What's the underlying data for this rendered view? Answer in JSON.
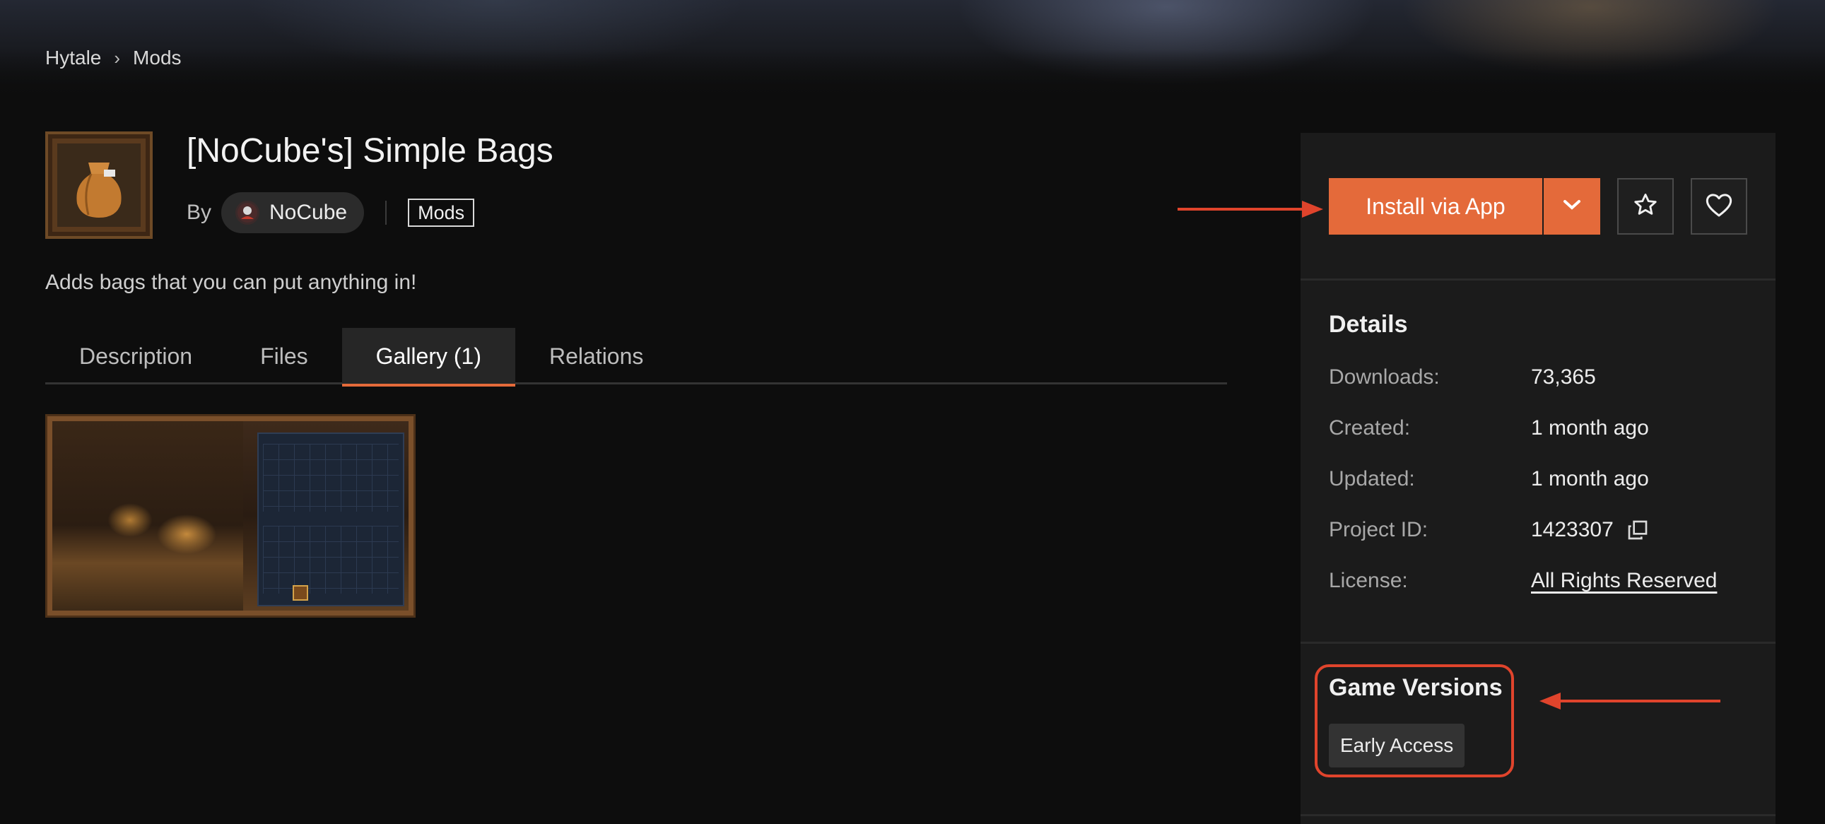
{
  "breadcrumb": {
    "items": [
      "Hytale",
      "Mods"
    ],
    "separator": "›"
  },
  "project": {
    "title": "[NoCube's] Simple Bags",
    "by_label": "By",
    "author": "NoCube",
    "category": "Mods",
    "summary": "Adds bags that you can put anything in!"
  },
  "tabs": [
    {
      "label": "Description",
      "active": false
    },
    {
      "label": "Files",
      "active": false
    },
    {
      "label": "Gallery (1)",
      "active": true
    },
    {
      "label": "Relations",
      "active": false
    }
  ],
  "actions": {
    "install_label": "Install via App",
    "dropdown_icon": "chevron-down-icon",
    "follow_icon": "star-icon",
    "favorite_icon": "heart-icon"
  },
  "details": {
    "title": "Details",
    "rows": [
      {
        "label": "Downloads:",
        "value": "73,365"
      },
      {
        "label": "Created:",
        "value": "1 month ago"
      },
      {
        "label": "Updated:",
        "value": "1 month ago"
      },
      {
        "label": "Project ID:",
        "value": "1423307"
      },
      {
        "label": "License:",
        "value": "All Rights Reserved"
      }
    ]
  },
  "game_versions": {
    "title": "Game Versions",
    "items": [
      "Early Access"
    ]
  },
  "colors": {
    "accent": "#e46a3a",
    "annotation": "#e0442c",
    "background": "#0d0d0d",
    "sidebar": "#1b1b1b"
  }
}
